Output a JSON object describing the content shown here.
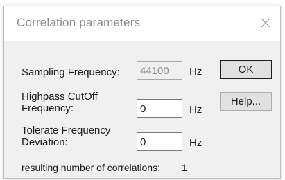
{
  "dialog": {
    "title": "Correlation parameters",
    "close_icon": "close-icon"
  },
  "fields": {
    "sampling_frequency": {
      "label": "Sampling Frequency:",
      "value": "44100",
      "unit": "Hz"
    },
    "highpass_cutoff": {
      "label_line1": "Highpass CutOff",
      "label_line2": "Frequency:",
      "value": "0",
      "unit": "Hz"
    },
    "tolerate_deviation": {
      "label_line1": "Tolerate Frequency",
      "label_line2": "Deviation:",
      "value": "0",
      "unit": "Hz"
    }
  },
  "result": {
    "label": "resulting number of correlations:",
    "value": "1"
  },
  "buttons": {
    "ok_label": "OK",
    "help_label": "Help..."
  }
}
